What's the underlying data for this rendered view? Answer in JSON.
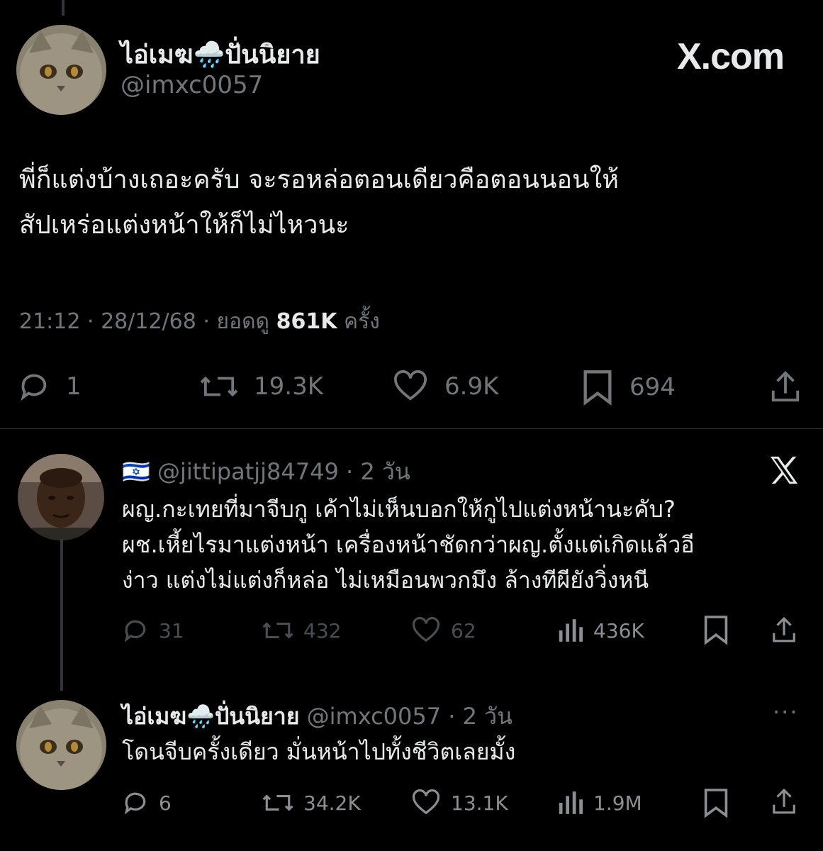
{
  "main_tweet": {
    "display_name": "ไอ่เมฆ🌧️ปั่นนิยาย",
    "handle": "@imxc0057",
    "brand": "X.com",
    "text_line1": "พี่ก็แต่งบ้างเถอะครับ จะรอหล่อตอนเดียวคือตอนนอนให้",
    "text_line2": "สัปเหร่อแต่งหน้าให้ก็ไม่ไหวนะ",
    "time": "21:12",
    "date": "28/12/68",
    "views_prefix": "ยอดดู",
    "views": "861K",
    "views_suffix": "ครั้ง",
    "stats": {
      "replies": "1",
      "reposts": "19.3K",
      "likes": "6.9K",
      "bookmarks": "694"
    }
  },
  "reply_1": {
    "flag": "🇮🇱",
    "handle": "@jittipatjj84749",
    "time": "2 วัน",
    "text_line1": "ผญ.กะเทยที่มาจีบกู เค้าไม่เห็นบอกให้กูไปแต่งหน้านะคับ?",
    "text_line2": "ผช.เหี้ยไรมาแต่งหน้า เครื่องหน้าชัดกว่าผญ.ตั้งแต่เกิดแล้วอี",
    "text_line3": "ง่าว แต่งไม่แต่งก็หล่อ ไม่เหมือนพวกมึง ล้างทีผียังวิ่งหนี",
    "stats": {
      "replies": "31",
      "reposts": "432",
      "likes": "62",
      "views": "436K"
    }
  },
  "reply_2": {
    "display_name": "ไอ่เมฆ🌧️ปั่นนิยาย",
    "handle": "@imxc0057",
    "time": "2 วัน",
    "text": "โดนจีบครั้งเดียว มั่นหน้าไปทั้งชีวิตเลยมั้ง",
    "stats": {
      "replies": "6",
      "reposts": "34.2K",
      "likes": "13.1K",
      "views": "1.9M"
    }
  },
  "colors": {
    "background": "#000000",
    "text_primary": "#e7e9ea",
    "text_secondary": "#71767b",
    "divider": "#2f3336"
  }
}
